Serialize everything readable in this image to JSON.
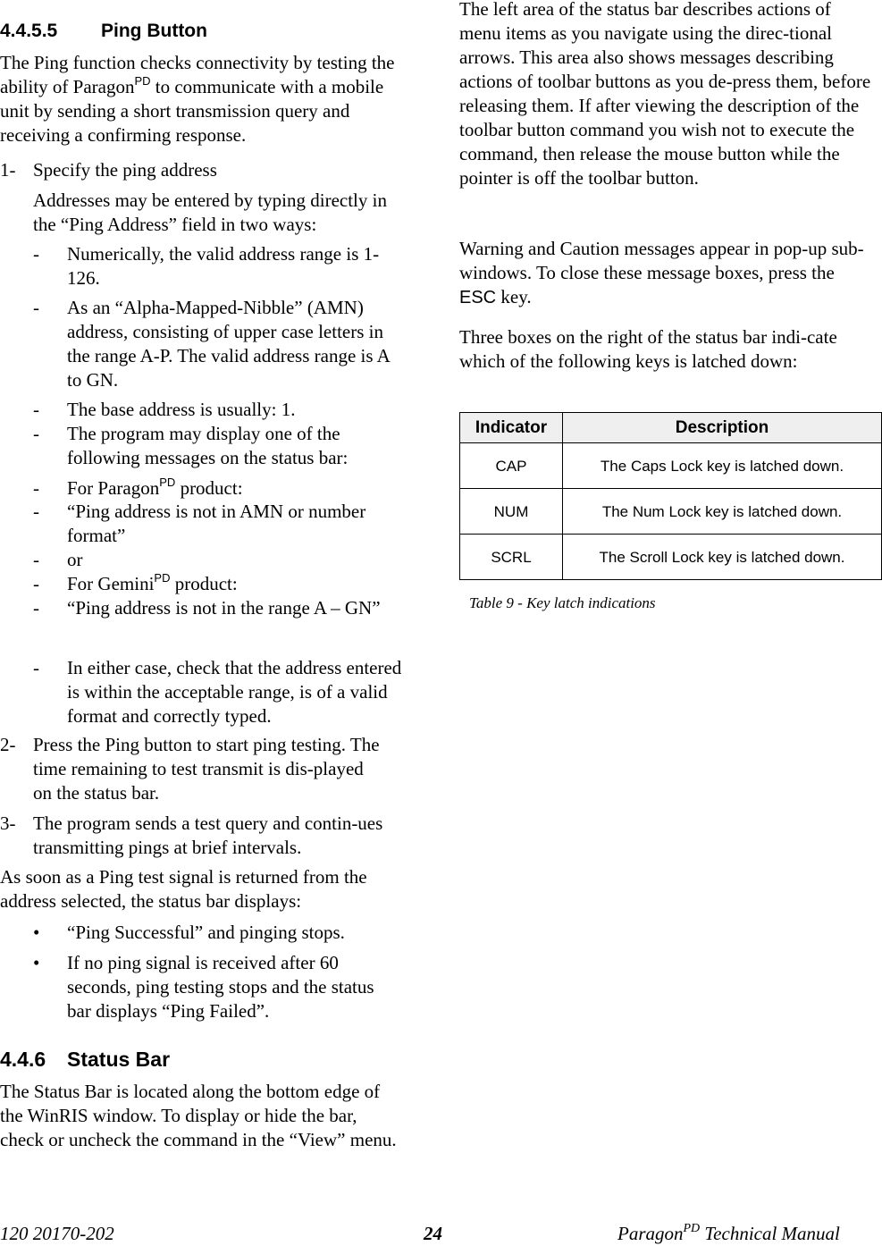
{
  "left": {
    "section_number": "4.4.5.5",
    "section_title": "Ping Button",
    "intro_before_sup": "The Ping function checks connectivity by testing the ability of Paragon",
    "intro_sup": "PD",
    "intro_after_sup": " to communicate with a mobile unit by sending a short transmission query and receiving a confirming response.",
    "step1_marker": "1-",
    "step1_title": "Specify the ping address",
    "step1_text": "Addresses may be entered by typing directly in the “Ping Address” field in two ways:",
    "dash_marker": "-",
    "dash_items": [
      "Numerically, the valid address range is 1-126.",
      "As an “Alpha-Mapped-Nibble”  (AMN) address, consisting of upper case letters in the range A-P. The valid address range is A to GN.",
      "The base address is usually: 1.",
      "The program may display one of the following messages on the status bar:",
      "For Paragon",
      "“Ping address is not in AMN or number format”",
      "or",
      "For Gemini",
      "“Ping address is not in the range A – GN”",
      "In either case, check that the address entered is within the acceptable range, is of a valid format and correctly typed."
    ],
    "sup_pd": "PD",
    "product_suffix": " product:",
    "step2_marker": "2-",
    "step2_text": "Press the Ping button to start ping testing. The time remaining to test transmit is dis-played on the status bar.",
    "step3_marker": "3-",
    "step3_text": "The program sends a test query and contin-ues transmitting pings at brief intervals.",
    "result_text": "As soon as a Ping test signal is returned from the address selected, the status bar displays:",
    "bullet_marker": "•",
    "bullets": [
      "“Ping Successful” and pinging stops.",
      "If no ping signal is received after 60 seconds, ping testing stops and the status bar displays “Ping Failed”."
    ],
    "status_section_number": "4.4.6",
    "status_section_title": "Status Bar",
    "status_text": "The Status Bar is located along the bottom edge of the WinRIS window. To display or hide the bar, check or uncheck the command in the “View” menu."
  },
  "right": {
    "para1": "The left area of the status bar describes actions of menu items as you navigate using the direc-tional arrows.  This area also shows messages describing actions of toolbar buttons as you de-press them, before releasing them.  If after viewing the description of the toolbar button command you wish not to execute the command, then release the mouse button while the pointer is off the toolbar button.",
    "para2_before": "Warning and Caution messages appear in pop-up sub-windows. To close these message boxes, press the ",
    "para2_key": "ESC",
    "para2_after": " key.",
    "para3": "Three boxes on the right of the status bar indi-cate which of the following keys is latched down:",
    "table": {
      "headers": [
        "Indicator",
        "Description"
      ],
      "rows": [
        [
          "CAP",
          "The Caps Lock key is latched down."
        ],
        [
          "NUM",
          "The Num Lock key is latched down."
        ],
        [
          "SCRL",
          "The Scroll Lock key is latched down."
        ]
      ]
    },
    "caption": "Table 9 - Key latch indications"
  },
  "footer": {
    "doc_number": "120 20170-202",
    "page_number": "24",
    "manual_name": "Paragon",
    "manual_sup": "PD",
    "manual_suffix": " Technical Manual"
  }
}
